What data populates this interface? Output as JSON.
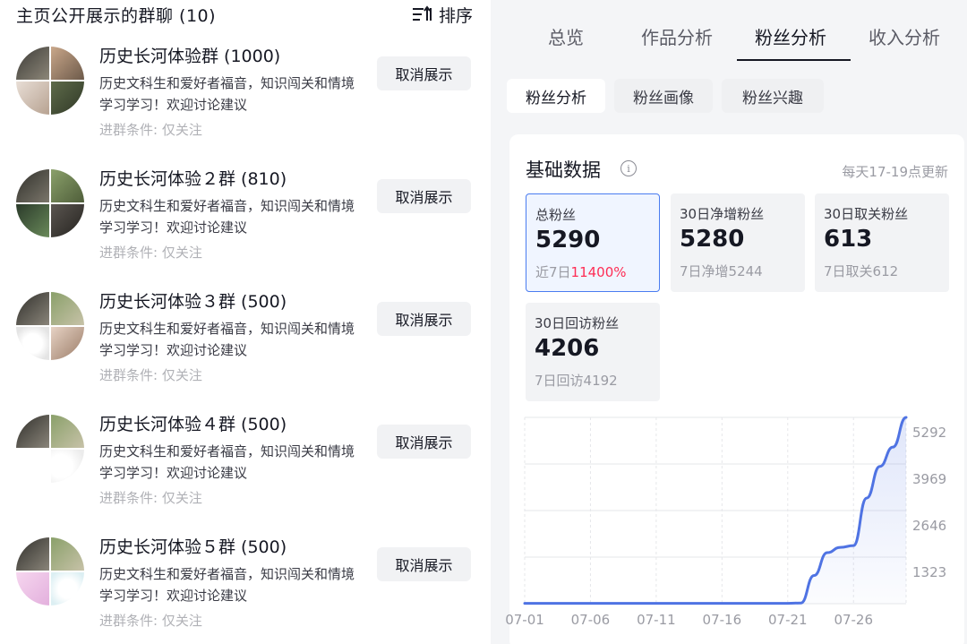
{
  "left_panel": {
    "title": "主页公开展示的群聊 (10)",
    "sort_label": "排序",
    "groups": [
      {
        "name": "历史长河体验群 (1000)",
        "desc": "历史文科生和爱好者福音，知识闯关和情境学习学习！欢迎讨论建议",
        "cond": "进群条件: 仅关注",
        "button": "取消展示"
      },
      {
        "name": "历史长河体验２群 (810)",
        "desc": "历史文科生和爱好者福音，知识闯关和情境学习学习！欢迎讨论建议",
        "cond": "进群条件: 仅关注",
        "button": "取消展示"
      },
      {
        "name": "历史长河体验３群 (500)",
        "desc": "历史文科生和爱好者福音，知识闯关和情境学习学习！欢迎讨论建议",
        "cond": "进群条件: 仅关注",
        "button": "取消展示"
      },
      {
        "name": "历史长河体验４群 (500)",
        "desc": "历史文科生和爱好者福音，知识闯关和情境学习学习！欢迎讨论建议",
        "cond": "进群条件: 仅关注",
        "button": "取消展示"
      },
      {
        "name": "历史长河体验５群 (500)",
        "desc": "历史文科生和爱好者福音，知识闯关和情境学习学习！欢迎讨论建议",
        "cond": "进群条件: 仅关注",
        "button": "取消展示"
      }
    ]
  },
  "right_panel": {
    "top_tabs": [
      "总览",
      "作品分析",
      "粉丝分析",
      "收入分析"
    ],
    "active_top_tab": "粉丝分析",
    "sub_tabs": [
      "粉丝分析",
      "粉丝画像",
      "粉丝兴趣"
    ],
    "active_sub_tab": "粉丝分析",
    "card": {
      "title": "基础数据",
      "info_icon_glyph": "i",
      "update_note": "每天17-19点更新",
      "stats": [
        {
          "label": "总粉丝",
          "value": "5290",
          "sub_prefix": "近7日",
          "sub_highlight": "11400%",
          "sub": ""
        },
        {
          "label": "30日净增粉丝",
          "value": "5280",
          "sub_prefix": "",
          "sub_highlight": "",
          "sub": "7日净增5244"
        },
        {
          "label": "30日取关粉丝",
          "value": "613",
          "sub_prefix": "",
          "sub_highlight": "",
          "sub": "7日取关612"
        },
        {
          "label": "30日回访粉丝",
          "value": "4206",
          "sub_prefix": "",
          "sub_highlight": "",
          "sub": "7日回访4192"
        }
      ]
    },
    "colors": {
      "accent": "#4a7cf0",
      "highlight": "#fe2c55",
      "line": "#4f73e3"
    }
  },
  "chart_data": {
    "type": "area",
    "x_ticks": [
      "07-01",
      "07-06",
      "07-11",
      "07-16",
      "07-21",
      "07-26"
    ],
    "y_ticks": [
      "5292",
      "3969",
      "2646",
      "1323"
    ],
    "ylim": [
      0,
      5292
    ],
    "grid": true,
    "series": [
      {
        "x": [
          "07-01",
          "07-02",
          "07-03",
          "07-04",
          "07-05",
          "07-06",
          "07-07",
          "07-08",
          "07-09",
          "07-10",
          "07-11",
          "07-12",
          "07-13",
          "07-14",
          "07-15",
          "07-16",
          "07-17",
          "07-18",
          "07-19",
          "07-20",
          "07-21",
          "07-22",
          "07-23",
          "07-24",
          "07-25",
          "07-26",
          "07-27",
          "07-28",
          "07-29",
          "07-30"
        ],
        "values": [
          10,
          10,
          10,
          10,
          10,
          10,
          10,
          10,
          10,
          10,
          10,
          10,
          10,
          10,
          10,
          10,
          10,
          10,
          10,
          10,
          10,
          20,
          800,
          1450,
          1600,
          1650,
          3000,
          3900,
          4450,
          5292
        ]
      }
    ]
  }
}
